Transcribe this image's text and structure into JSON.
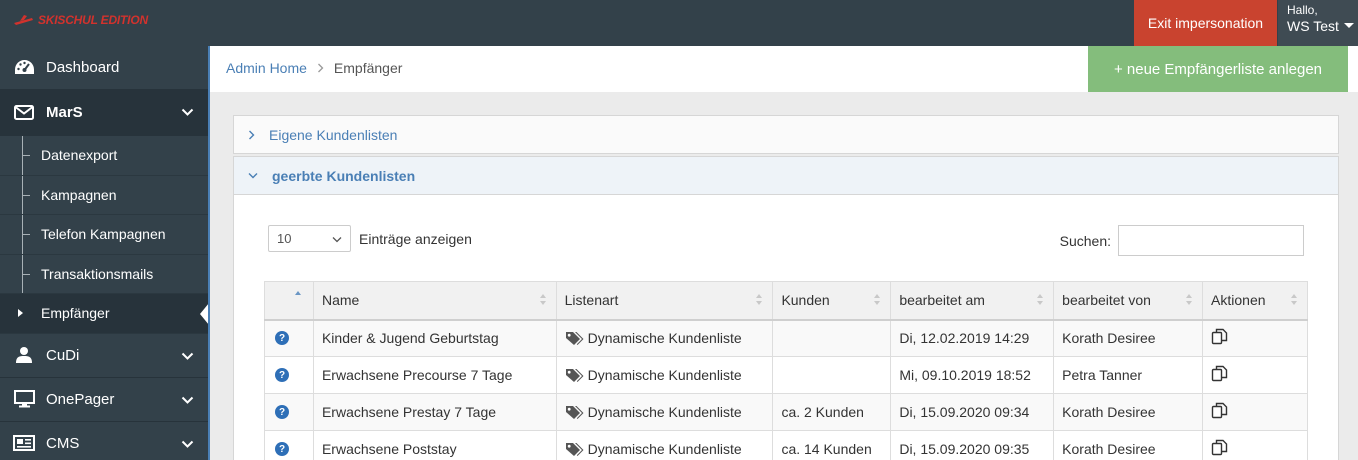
{
  "brand": {
    "logo_text": "SKISCHUL EDITION",
    "accent": "#d2322d"
  },
  "topbar": {
    "exit_label": "Exit impersonation",
    "greeting": "Hallo,",
    "user_name": "WS Test"
  },
  "sidebar": {
    "items": [
      {
        "label": "Dashboard",
        "icon": "dashboard-icon"
      },
      {
        "label": "MarS",
        "icon": "envelope-icon"
      },
      {
        "label": "CuDi",
        "icon": "user-icon"
      },
      {
        "label": "OnePager",
        "icon": "monitor-icon"
      },
      {
        "label": "CMS",
        "icon": "newspaper-icon"
      }
    ],
    "mars_sub": [
      {
        "label": "Datenexport"
      },
      {
        "label": "Kampagnen"
      },
      {
        "label": "Telefon Kampagnen"
      },
      {
        "label": "Transaktionsmails"
      },
      {
        "label": "Empfänger"
      }
    ]
  },
  "breadcrumb": {
    "home": "Admin Home",
    "current": "Empfänger"
  },
  "actions": {
    "new_list": "+ neue Empfängerliste anlegen"
  },
  "panels": {
    "own": {
      "title": "Eigene Kundenlisten"
    },
    "inherited": {
      "title": "geerbte Kundenlisten"
    }
  },
  "table_controls": {
    "page_length": "10",
    "length_label": "Einträge anzeigen",
    "search_label": "Suchen:",
    "search_value": ""
  },
  "table": {
    "headers": [
      "Name",
      "Listenart",
      "Kunden",
      "bearbeitet am",
      "bearbeitet von",
      "Aktionen"
    ],
    "rows": [
      {
        "name": "Kinder & Jugend Geburtstag",
        "type": "Dynamische Kundenliste",
        "customers": "",
        "edited_at": "Di, 12.02.2019 14:29",
        "edited_by": "Korath Desiree"
      },
      {
        "name": "Erwachsene Precourse 7 Tage",
        "type": "Dynamische Kundenliste",
        "customers": "",
        "edited_at": "Mi, 09.10.2019 18:52",
        "edited_by": "Petra Tanner"
      },
      {
        "name": "Erwachsene Prestay 7 Tage",
        "type": "Dynamische Kundenliste",
        "customers": "ca. 2 Kunden",
        "edited_at": "Di, 15.09.2020 09:34",
        "edited_by": "Korath Desiree"
      },
      {
        "name": "Erwachsene Poststay",
        "type": "Dynamische Kundenliste",
        "customers": "ca. 14 Kunden",
        "edited_at": "Di, 15.09.2020 09:35",
        "edited_by": "Korath Desiree"
      }
    ]
  }
}
